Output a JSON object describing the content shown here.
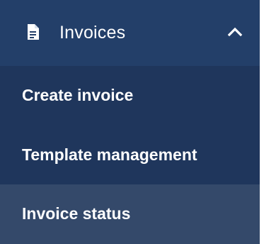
{
  "menu": {
    "header": {
      "icon": "document-icon",
      "label": "Invoices",
      "expanded_indicator": "chevron-up-icon"
    },
    "items": [
      {
        "label": "Create invoice",
        "selected": false
      },
      {
        "label": "Template management",
        "selected": false
      },
      {
        "label": "Invoice status",
        "selected": true
      }
    ]
  },
  "colors": {
    "header_bg": "#233f69",
    "menu_bg": "#1f365c",
    "selected_bg": "#34496a",
    "text": "#ffffff"
  }
}
